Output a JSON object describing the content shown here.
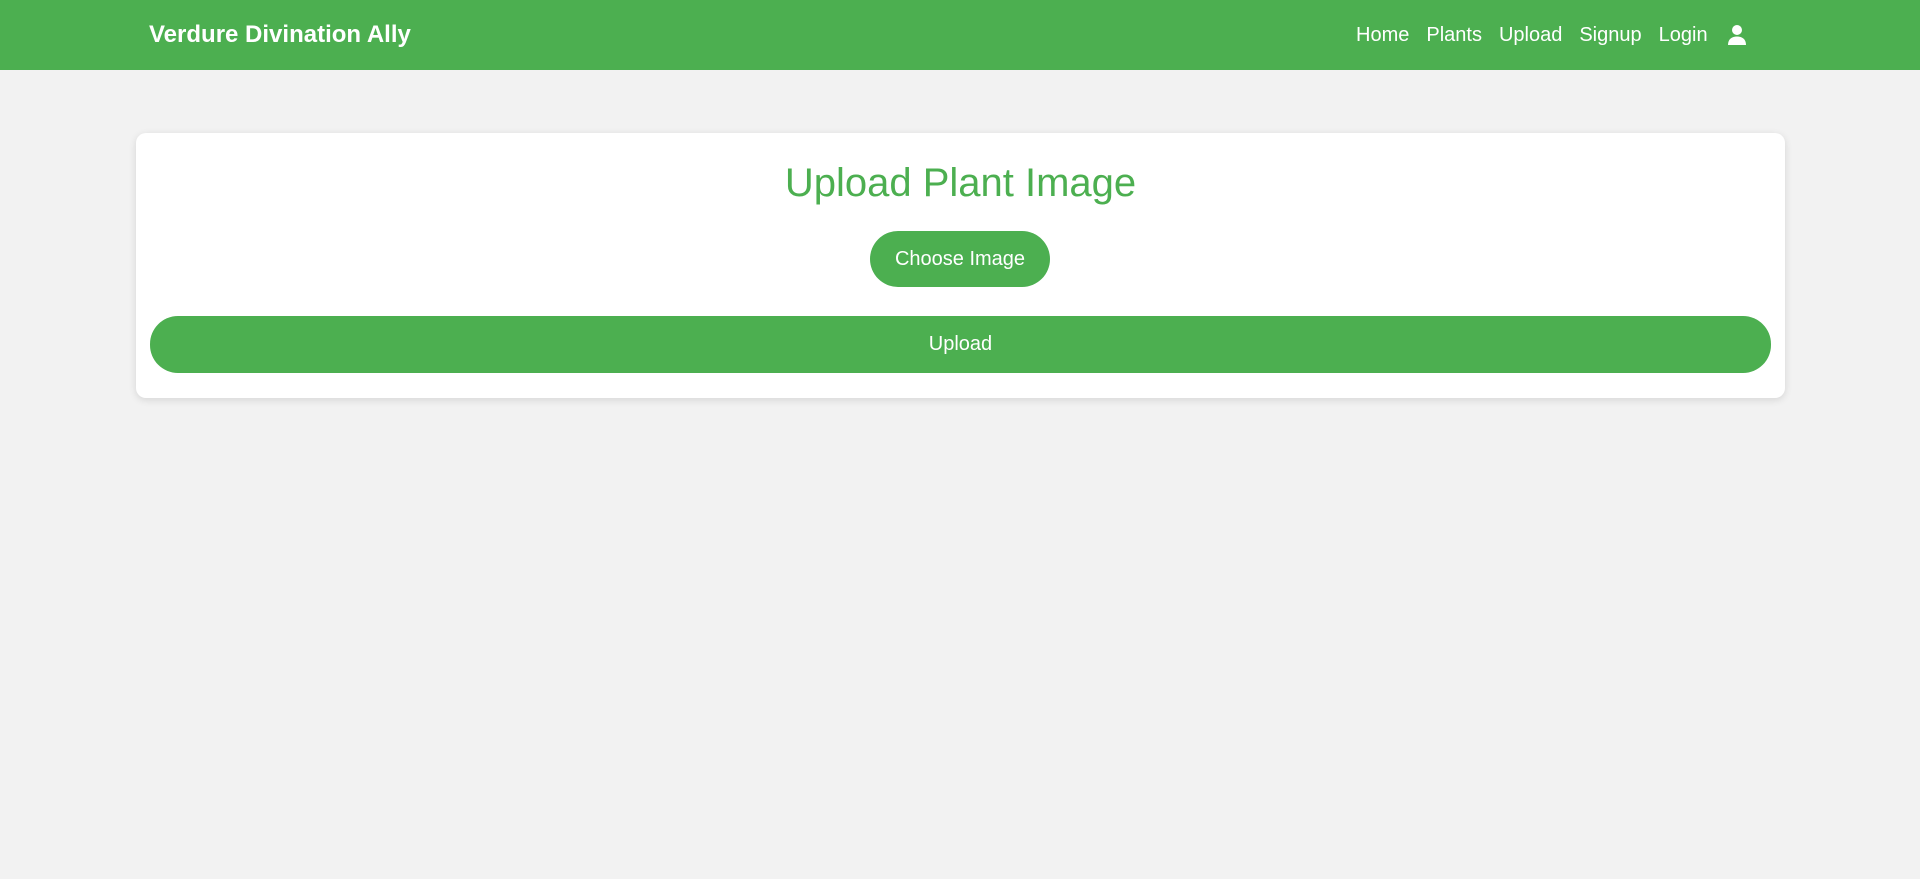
{
  "navbar": {
    "brand": "Verdure Divination Ally",
    "links": [
      {
        "label": "Home"
      },
      {
        "label": "Plants"
      },
      {
        "label": "Upload"
      },
      {
        "label": "Signup"
      },
      {
        "label": "Login"
      }
    ],
    "user_icon": "user-icon",
    "background_color": "#4caf50"
  },
  "main": {
    "title": "Upload Plant Image",
    "choose_button_label": "Choose Image",
    "upload_button_label": "Upload",
    "accent_color": "#4caf50",
    "page_background": "#f2f2f2"
  }
}
